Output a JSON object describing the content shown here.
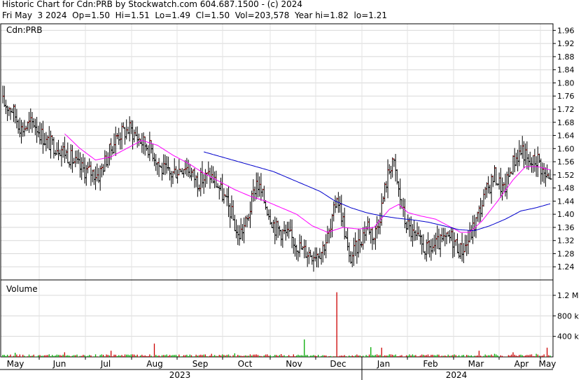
{
  "header": {
    "title_line": "Historic Chart for Cdn:PRB by Stockwatch.com 604.687.1500 - (c) 2024",
    "quote_line": "Fri May  3 2024  Op=1.50  Hi=1.51  Lo=1.49  Cl=1.50  Vol=203,578  Year hi=1.82  lo=1.21"
  },
  "price_panel": {
    "label": "Cdn:PRB"
  },
  "volume_panel": {
    "label": "Volume"
  },
  "chart_data": {
    "type": "ohlc-bar with moving averages and volume",
    "symbol": "Cdn:PRB",
    "price_axis": {
      "min": 1.2,
      "max": 1.98,
      "ticks": [
        1.24,
        1.28,
        1.32,
        1.36,
        1.4,
        1.44,
        1.48,
        1.52,
        1.56,
        1.6,
        1.64,
        1.68,
        1.72,
        1.76,
        1.8,
        1.84,
        1.88,
        1.92,
        1.96
      ]
    },
    "volume_axis": {
      "min": 0,
      "max": 1500000,
      "ticks": [
        400000,
        800000,
        1200000
      ],
      "tick_labels": [
        "400 k",
        "800 k",
        "1.2 M"
      ]
    },
    "months": [
      "May",
      "Jun",
      "Jul",
      "Aug",
      "Sep",
      "Oct",
      "Nov",
      "Dec",
      "Jan",
      "Feb",
      "Mar",
      "Apr",
      "May"
    ],
    "years": [
      "2023",
      "2024"
    ],
    "price_anchors": [
      [
        0,
        1.74
      ],
      [
        6,
        1.72
      ],
      [
        12,
        1.66
      ],
      [
        20,
        1.68
      ],
      [
        28,
        1.62
      ],
      [
        38,
        1.6
      ],
      [
        50,
        1.54
      ],
      [
        62,
        1.52
      ],
      [
        68,
        1.58
      ],
      [
        74,
        1.64
      ],
      [
        82,
        1.66
      ],
      [
        90,
        1.62
      ],
      [
        96,
        1.6
      ],
      [
        102,
        1.54
      ],
      [
        108,
        1.52
      ],
      [
        118,
        1.55
      ],
      [
        126,
        1.5
      ],
      [
        134,
        1.52
      ],
      [
        140,
        1.48
      ],
      [
        148,
        1.4
      ],
      [
        152,
        1.33
      ],
      [
        158,
        1.38
      ],
      [
        164,
        1.5
      ],
      [
        170,
        1.43
      ],
      [
        176,
        1.36
      ],
      [
        186,
        1.33
      ],
      [
        194,
        1.29
      ],
      [
        200,
        1.28
      ],
      [
        206,
        1.29
      ],
      [
        212,
        1.35
      ],
      [
        216,
        1.46
      ],
      [
        220,
        1.38
      ],
      [
        224,
        1.26
      ],
      [
        230,
        1.31
      ],
      [
        236,
        1.37
      ],
      [
        240,
        1.33
      ],
      [
        244,
        1.4
      ],
      [
        248,
        1.5
      ],
      [
        252,
        1.57
      ],
      [
        256,
        1.47
      ],
      [
        260,
        1.38
      ],
      [
        266,
        1.33
      ],
      [
        274,
        1.29
      ],
      [
        282,
        1.31
      ],
      [
        290,
        1.33
      ],
      [
        296,
        1.29
      ],
      [
        300,
        1.31
      ],
      [
        306,
        1.38
      ],
      [
        312,
        1.46
      ],
      [
        318,
        1.52
      ],
      [
        324,
        1.47
      ],
      [
        330,
        1.56
      ],
      [
        336,
        1.6
      ],
      [
        340,
        1.55
      ],
      [
        346,
        1.57
      ],
      [
        350,
        1.52
      ],
      [
        354,
        1.5
      ]
    ],
    "ma_short_anchors": [
      [
        40,
        1.645
      ],
      [
        50,
        1.6
      ],
      [
        60,
        1.565
      ],
      [
        70,
        1.575
      ],
      [
        80,
        1.6
      ],
      [
        90,
        1.625
      ],
      [
        100,
        1.61
      ],
      [
        110,
        1.58
      ],
      [
        120,
        1.555
      ],
      [
        130,
        1.525
      ],
      [
        140,
        1.5
      ],
      [
        150,
        1.475
      ],
      [
        160,
        1.455
      ],
      [
        170,
        1.44
      ],
      [
        180,
        1.42
      ],
      [
        190,
        1.4
      ],
      [
        200,
        1.365
      ],
      [
        210,
        1.345
      ],
      [
        220,
        1.36
      ],
      [
        230,
        1.355
      ],
      [
        240,
        1.36
      ],
      [
        250,
        1.415
      ],
      [
        256,
        1.43
      ],
      [
        262,
        1.405
      ],
      [
        270,
        1.395
      ],
      [
        280,
        1.385
      ],
      [
        290,
        1.36
      ],
      [
        296,
        1.345
      ],
      [
        302,
        1.345
      ],
      [
        310,
        1.38
      ],
      [
        320,
        1.44
      ],
      [
        330,
        1.505
      ],
      [
        338,
        1.545
      ],
      [
        346,
        1.545
      ],
      [
        354,
        1.535
      ]
    ],
    "ma_long_anchors": [
      [
        130,
        1.59
      ],
      [
        145,
        1.57
      ],
      [
        160,
        1.55
      ],
      [
        175,
        1.53
      ],
      [
        190,
        1.5
      ],
      [
        205,
        1.47
      ],
      [
        215,
        1.44
      ],
      [
        225,
        1.42
      ],
      [
        235,
        1.405
      ],
      [
        245,
        1.395
      ],
      [
        255,
        1.388
      ],
      [
        265,
        1.383
      ],
      [
        275,
        1.376
      ],
      [
        285,
        1.365
      ],
      [
        295,
        1.353
      ],
      [
        305,
        1.35
      ],
      [
        315,
        1.365
      ],
      [
        325,
        1.385
      ],
      [
        335,
        1.41
      ],
      [
        345,
        1.42
      ],
      [
        354,
        1.432
      ]
    ],
    "volume_spikes": [
      [
        0,
        40000
      ],
      [
        8,
        80000
      ],
      [
        40,
        90000
      ],
      [
        70,
        120000
      ],
      [
        98,
        260000
      ],
      [
        135,
        60000
      ],
      [
        150,
        70000
      ],
      [
        165,
        40000
      ],
      [
        180,
        55000
      ],
      [
        195,
        340000
      ],
      [
        208,
        30000
      ],
      [
        216,
        1260000
      ],
      [
        228,
        30000
      ],
      [
        238,
        190000
      ],
      [
        245,
        180000
      ],
      [
        250,
        50000
      ],
      [
        264,
        30000
      ],
      [
        280,
        30000
      ],
      [
        300,
        40000
      ],
      [
        308,
        120000
      ],
      [
        318,
        60000
      ],
      [
        330,
        90000
      ],
      [
        345,
        60000
      ],
      [
        352,
        180000
      ]
    ],
    "colors": {
      "bars": "#000000",
      "up_tick": "#cc0000",
      "ma_short": "#ff00ff",
      "ma_long": "#0000cc",
      "volume_up": "#00aa00",
      "volume_down": "#cc0000"
    },
    "grid": true
  }
}
